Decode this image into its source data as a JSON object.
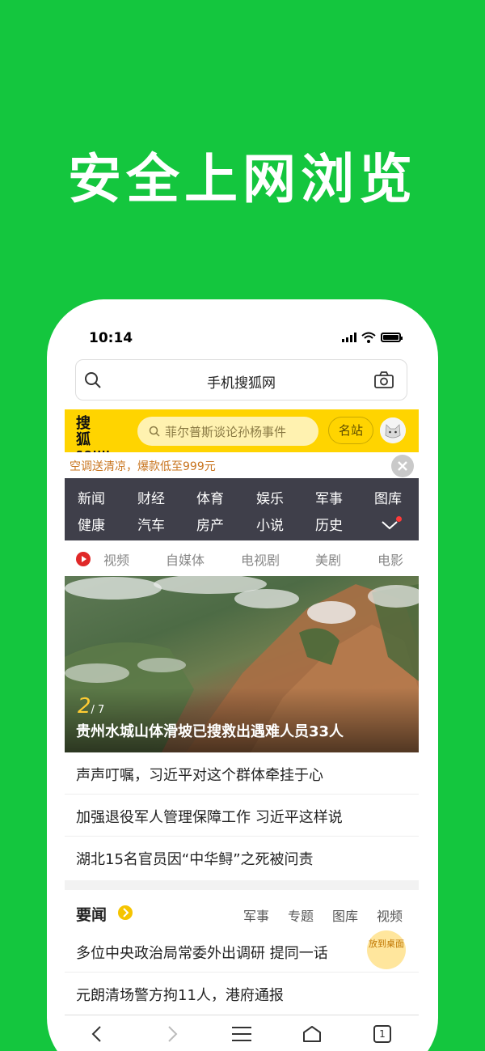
{
  "banner": {
    "headline": "安全上网浏览"
  },
  "status_bar": {
    "time": "10:14"
  },
  "address_bar": {
    "title": "手机搜狐网"
  },
  "header": {
    "logo_cn": "搜 狐",
    "logo_en": "SOHU.com",
    "search_placeholder": "菲尔普斯谈论孙杨事件",
    "mingzhan_label": "名站",
    "brand_color": "#ffd400"
  },
  "promo": {
    "text": "空调送清凉，爆款低至999元"
  },
  "categories": {
    "row1": [
      "新闻",
      "财经",
      "体育",
      "娱乐",
      "军事",
      "图库"
    ],
    "row2": [
      "健康",
      "汽车",
      "房产",
      "小说",
      "历史"
    ]
  },
  "video_tabs": [
    "视频",
    "自媒体",
    "电视剧",
    "美剧",
    "电影"
  ],
  "hero": {
    "index": "2",
    "total": "/ 7",
    "caption": "贵州水城山体滑坡已搜救出遇难人员33人"
  },
  "news": [
    "声声叮嘱，习近平对这个群体牵挂于心",
    "加强退役军人管理保障工作 习近平这样说",
    "湖北15名官员因“中华鲟”之死被问责"
  ],
  "section": {
    "title": "要闻",
    "tags": [
      "军事",
      "专题",
      "图库",
      "视频"
    ],
    "items": [
      "多位中央政治局常委外出调研 提同一话",
      "元朗清场警方拘11人，港府通报"
    ],
    "desk_label": "放到桌面"
  },
  "toolbar": {
    "tab_count": "1"
  }
}
